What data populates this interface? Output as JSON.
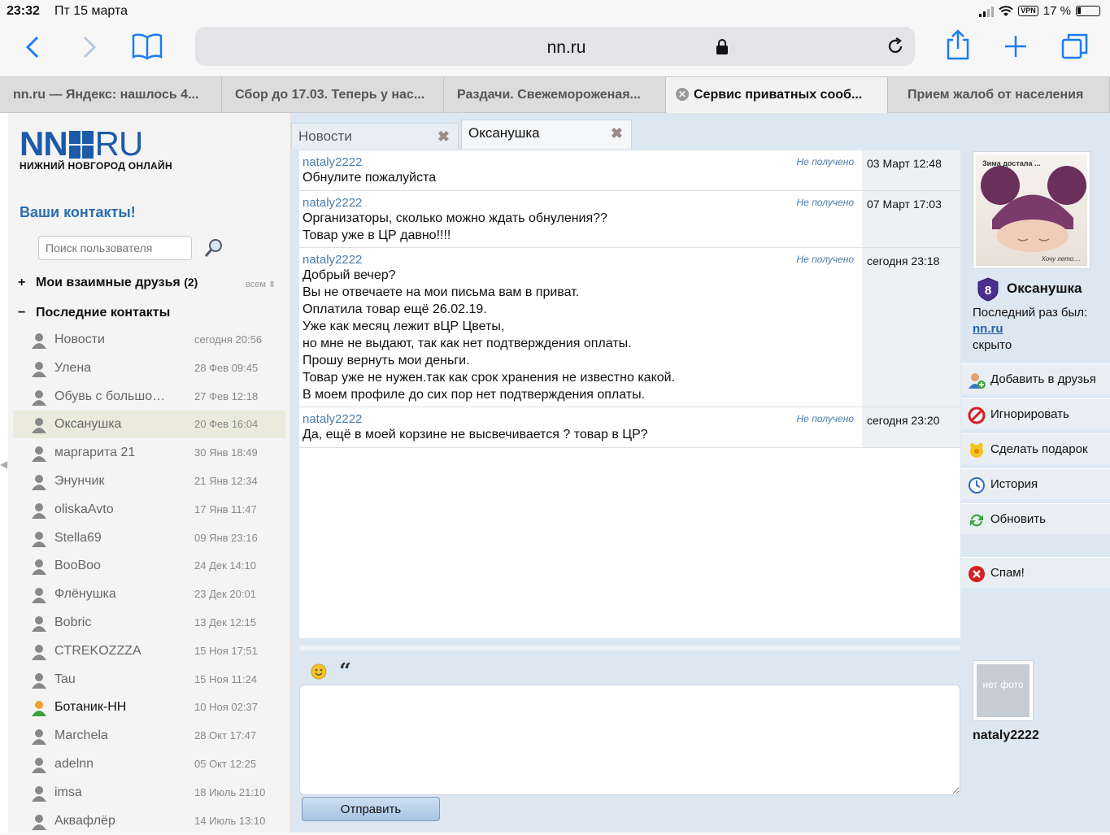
{
  "status_bar": {
    "time": "23:32",
    "date": "Пт 15 марта",
    "vpn": "VPN",
    "battery": "17 %"
  },
  "browser": {
    "url": "nn.ru",
    "tabs": [
      {
        "label": "nn.ru — Яндекс: нашлось 4..."
      },
      {
        "label": "Сбор до 17.03. Теперь у нас..."
      },
      {
        "label": "Раздачи. Свежемороженая..."
      },
      {
        "label": "Сервис приватных сооб..."
      },
      {
        "label": "Прием жалоб от населения"
      }
    ]
  },
  "logo": {
    "big_left": "NN",
    "big_right": "RU",
    "subtitle": "НИЖНИЙ НОВГОРОД ОНЛАЙН"
  },
  "sidebar": {
    "title": "Ваши контакты!",
    "search_placeholder": "Поиск пользователя",
    "friends_group": {
      "sign": "+",
      "label": "Мои взаимные друзья",
      "count": "(2)",
      "sort": "всем"
    },
    "recent_group": {
      "sign": "−",
      "label": "Последние контакты"
    },
    "contacts": [
      {
        "name": "Новости",
        "time": "сегодня 20:56"
      },
      {
        "name": "Улена",
        "time": "28 Фев 09:45"
      },
      {
        "name": "Обувь с большой бу...",
        "time": "27 Фев 12:18"
      },
      {
        "name": "Оксанушка",
        "time": "20 Фев 16:04"
      },
      {
        "name": "маргарита 21",
        "time": "30 Янв 18:49"
      },
      {
        "name": "Энунчик",
        "time": "21 Янв 12:34"
      },
      {
        "name": "oliskaAvto",
        "time": "17 Янв 11:47"
      },
      {
        "name": "Stella69",
        "time": "09 Янв 23:16"
      },
      {
        "name": "BooBoo",
        "time": "24 Дек 14:10"
      },
      {
        "name": "Флёнушка",
        "time": "23 Дек 20:01"
      },
      {
        "name": "Bobric",
        "time": "13 Дек 12:15"
      },
      {
        "name": "CTREKOZZZA",
        "time": "15 Ноя 17:51"
      },
      {
        "name": "Tau",
        "time": "15 Ноя 11:24"
      },
      {
        "name": "Ботаник-НН",
        "time": "10 Ноя 02:37"
      },
      {
        "name": "Marchela",
        "time": "28 Окт 17:47"
      },
      {
        "name": "adelnn",
        "time": "05 Окт 12:25"
      },
      {
        "name": "imsa",
        "time": "18 Июль 21:10"
      },
      {
        "name": "Аквафлёр",
        "time": "14 Июль 13:10"
      }
    ]
  },
  "chat": {
    "tabs": [
      {
        "label": "Новости",
        "close": "✖"
      },
      {
        "label": "Оксанушка",
        "close": "✖"
      }
    ],
    "messages": [
      {
        "author": "nataly2222",
        "status": "Не получено",
        "time": "03 Март 12:48",
        "lines": [
          "Обнулите пожалуйста"
        ]
      },
      {
        "author": "nataly2222",
        "status": "Не получено",
        "time": "07 Март 17:03",
        "lines": [
          "Организаторы, сколько можно ждать обнуления??",
          "Товар уже в ЦР давно!!!!"
        ]
      },
      {
        "author": "nataly2222",
        "status": "Не получено",
        "time": "сегодня 23:18",
        "lines": [
          "Добрый вечер?",
          "Вы не отвечаете на мои письма вам в приват.",
          "Оплатила товар ещё 26.02.19.",
          "Уже как месяц лежит вЦР Цветы,",
          "но мне не выдают, так как нет подтверждения оплаты.",
          "Прошу вернуть мои деньги.",
          "Товар уже не нужен.так как срок хранения не известно какой.",
          "В моем профиле до сих пор нет подтверждения оплаты."
        ]
      },
      {
        "author": "nataly2222",
        "status": "Не получено",
        "time": "сегодня 23:20",
        "lines": [
          "Да, ещё в моей корзине не высвечивается ? товар в ЦР?"
        ]
      }
    ],
    "quote_glyph": "“",
    "send_label": "Отправить"
  },
  "profile": {
    "photo_caption_top": "Зима достала ...",
    "photo_caption_bottom": "Хочу лето....",
    "level": "8",
    "name": "Оксанушка",
    "last_seen_label": "Последний раз был:",
    "last_seen_site": "nn.ru",
    "last_seen_value": "скрыто",
    "actions": [
      {
        "label": "Добавить в друзья",
        "icon": "add-friend-icon"
      },
      {
        "label": "Игнорировать",
        "icon": "ignore-icon"
      },
      {
        "label": "Сделать подарок",
        "icon": "gift-icon"
      },
      {
        "label": "История",
        "icon": "history-icon"
      },
      {
        "label": "Обновить",
        "icon": "refresh-icon"
      },
      {
        "label": "Спам!",
        "icon": "spam-icon"
      }
    ],
    "my_photo_text": "нет фото",
    "my_name": "nataly2222"
  }
}
